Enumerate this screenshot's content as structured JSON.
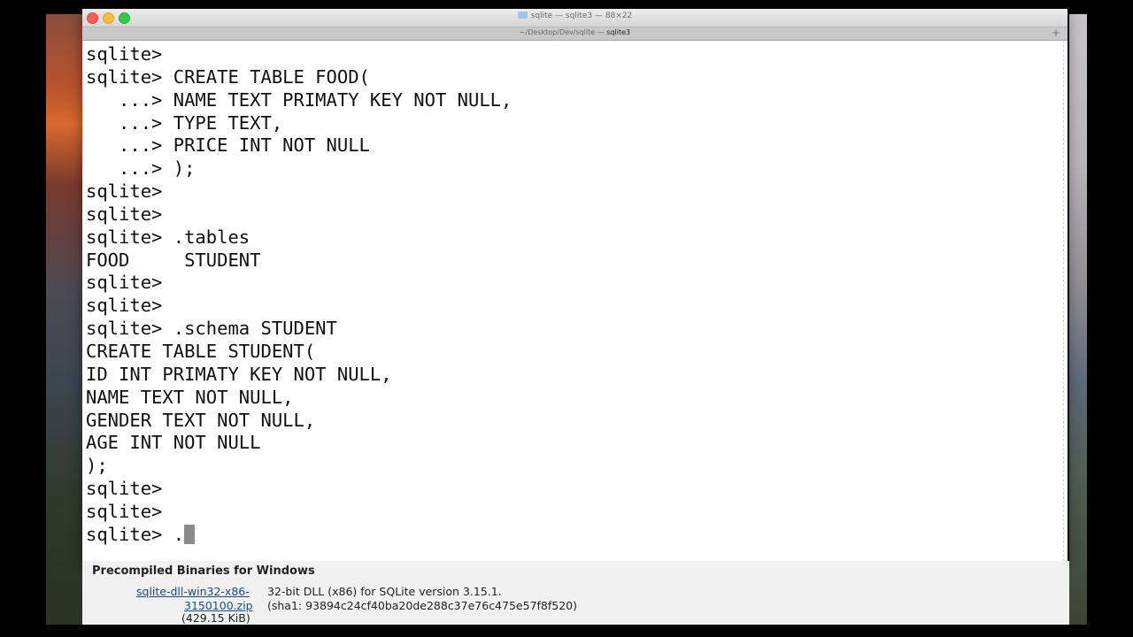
{
  "window": {
    "title": "sqlite — sqlite3 — 88×22",
    "tab_path": "~/Desktop/Dev/sqlite — ",
    "tab_name": "sqlite3",
    "new_tab_label": "+"
  },
  "terminal": {
    "lines": [
      "sqlite>",
      "sqlite> CREATE TABLE FOOD(",
      "   ...> NAME TEXT PRIMATY KEY NOT NULL,",
      "   ...> TYPE TEXT,",
      "   ...> PRICE INT NOT NULL",
      "   ...> );",
      "sqlite>",
      "sqlite>",
      "sqlite> .tables",
      "FOOD     STUDENT",
      "sqlite>",
      "sqlite>",
      "sqlite> .schema STUDENT",
      "CREATE TABLE STUDENT(",
      "ID INT PRIMATY KEY NOT NULL,",
      "NAME TEXT NOT NULL,",
      "GENDER TEXT NOT NULL,",
      "AGE INT NOT NULL",
      ");",
      "sqlite>",
      "sqlite>"
    ],
    "current_input": "sqlite> ."
  },
  "browser": {
    "heading": "Precompiled Binaries for Windows",
    "link_line1": "sqlite-dll-win32-x86-",
    "link_line2": "3150100.zip",
    "size": "(429.15 KiB)",
    "description": "32-bit DLL (x86) for SQLite version 3.15.1.",
    "hash": "(sha1: 93894c24cf40ba20de288c37e76c475e57f8f520)"
  },
  "colors": {
    "terminal_background": "#ffffff",
    "terminal_text": "#111111",
    "link": "#1a4a8a"
  }
}
